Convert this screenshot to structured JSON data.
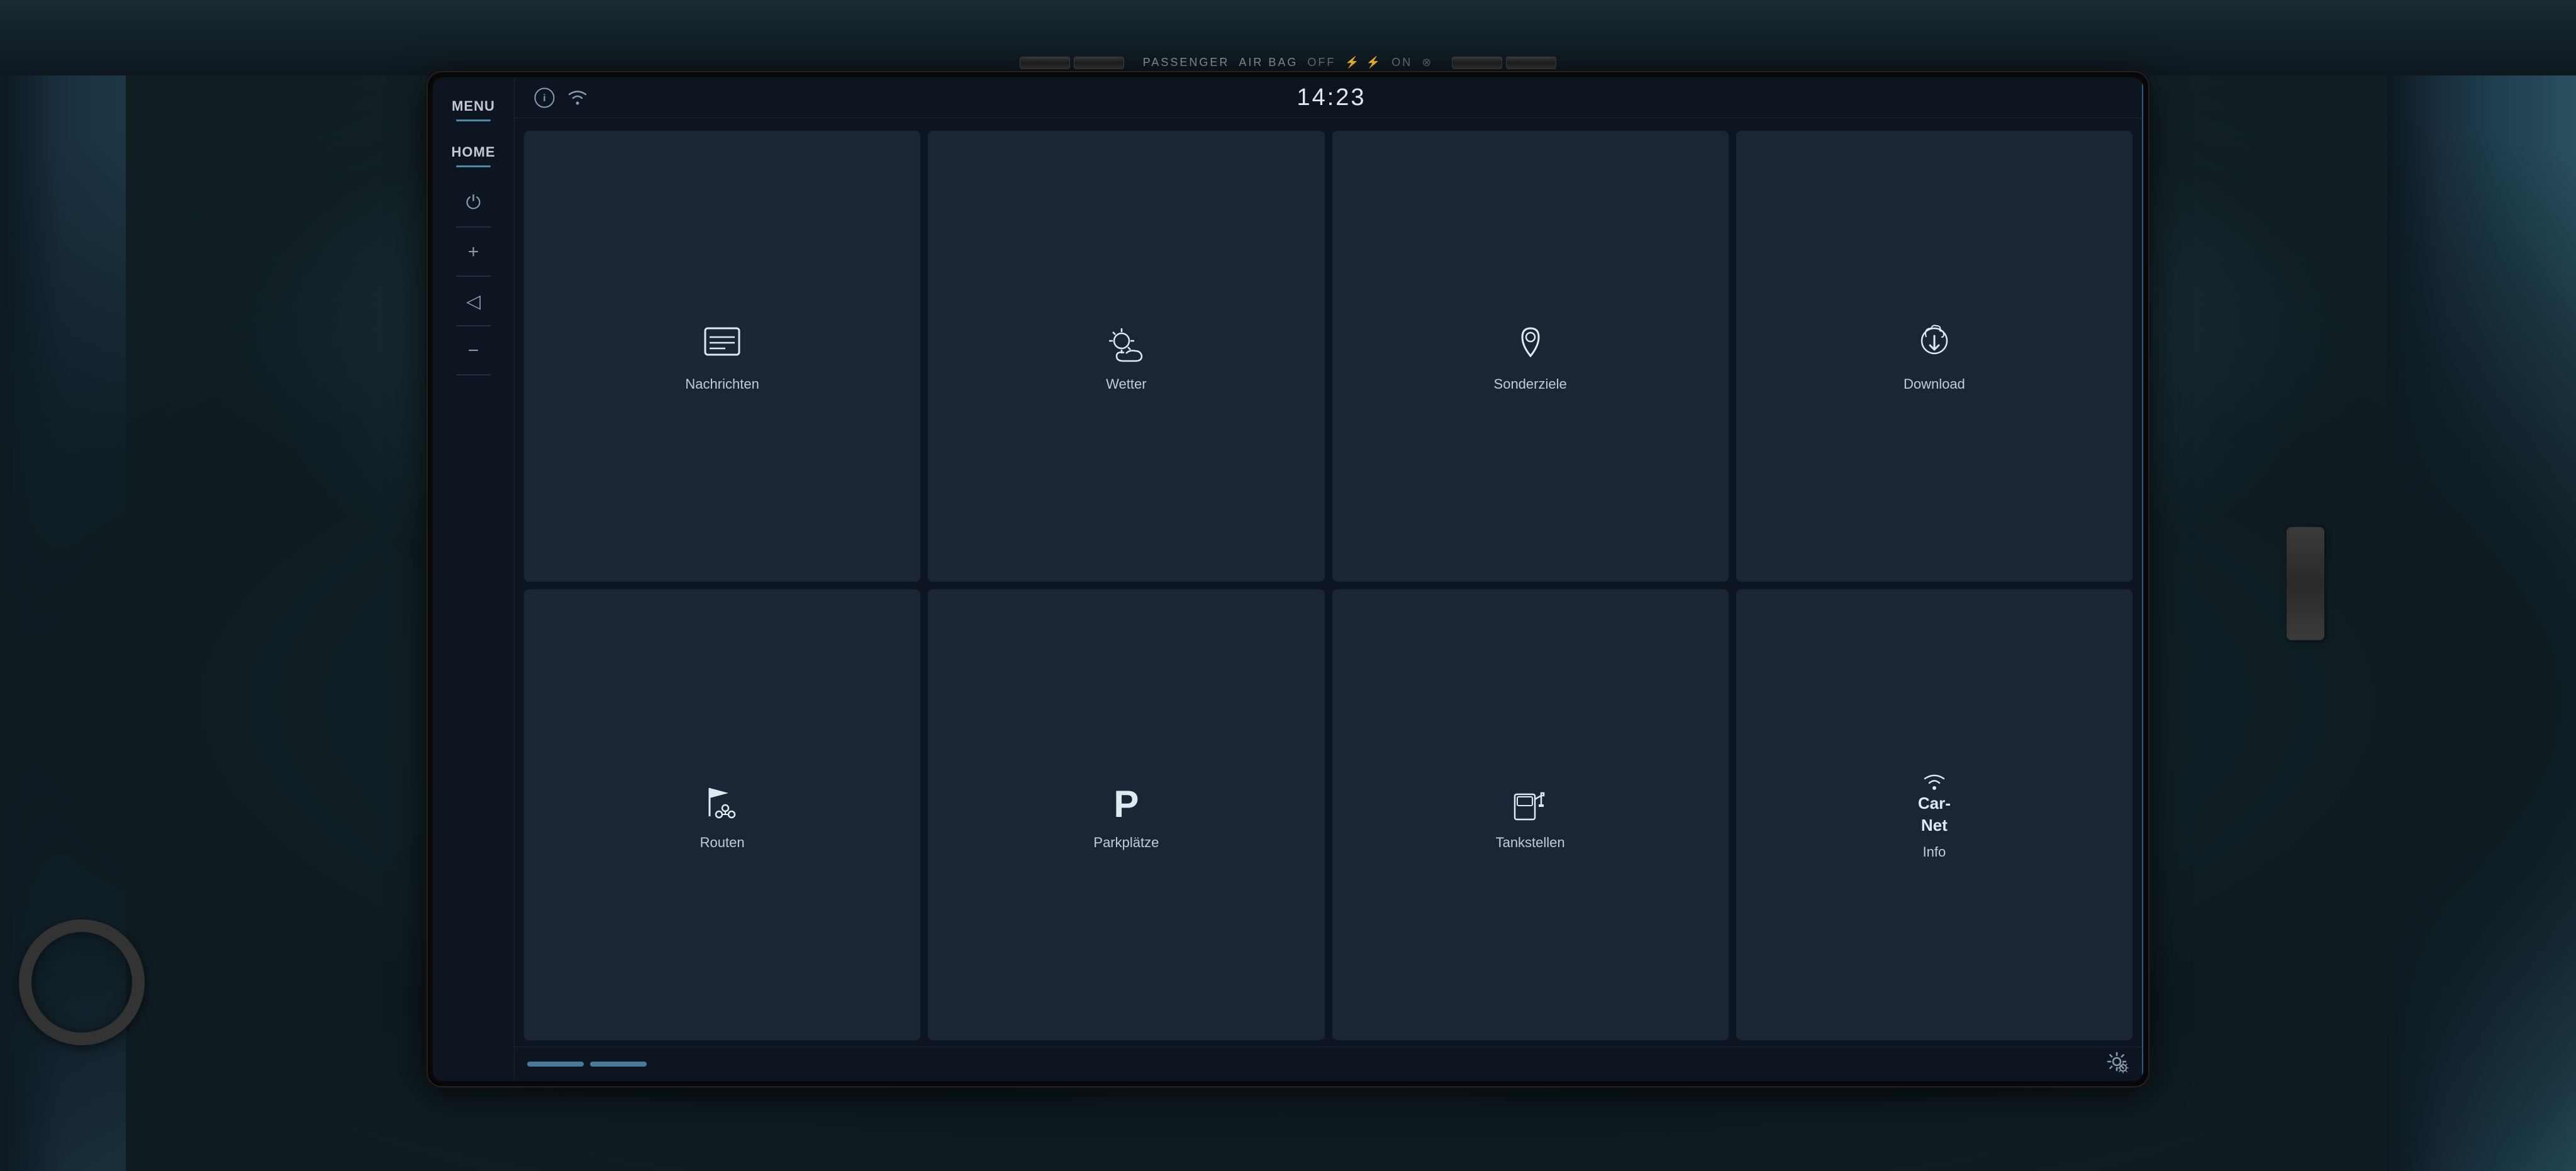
{
  "airbag": {
    "text": "PASSENGER",
    "text2": "AIR BAG",
    "off_label": "OFF",
    "on_label": "ON"
  },
  "statusBar": {
    "time": "14:23"
  },
  "sidebar": {
    "menu_label": "MENU",
    "home_label": "HOME"
  },
  "grid": {
    "row1": [
      {
        "id": "nachrichten",
        "label": "Nachrichten",
        "icon": "news"
      },
      {
        "id": "wetter",
        "label": "Wetter",
        "icon": "weather"
      },
      {
        "id": "sonderziele",
        "label": "Sonderziele",
        "icon": "poi"
      },
      {
        "id": "download",
        "label": "Download",
        "icon": "download"
      }
    ],
    "row2": [
      {
        "id": "routen",
        "label": "Routen",
        "icon": "routes"
      },
      {
        "id": "parkplaetze",
        "label": "Parkplätze",
        "icon": "parking"
      },
      {
        "id": "tankstellen",
        "label": "Tankstellen",
        "icon": "fuel"
      },
      {
        "id": "info",
        "label": "Info",
        "icon": "carnet"
      }
    ]
  },
  "bottomBar": {
    "settings_label": "⚙"
  },
  "colors": {
    "accent": "#4a8aaa",
    "screenBg": "#0d1520",
    "cellBg": "#1a2535",
    "text": "#c0ccd8",
    "iconColor": "#e0e8f0"
  }
}
